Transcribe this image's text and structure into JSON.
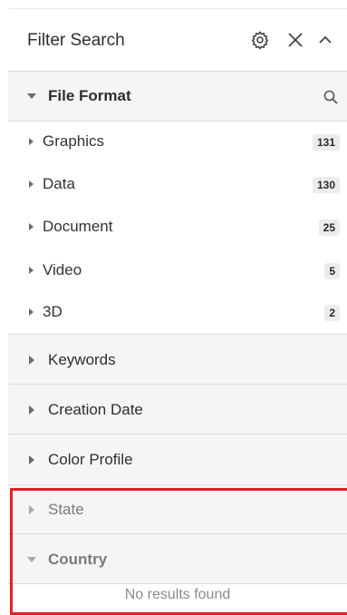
{
  "header": {
    "title": "Filter Search"
  },
  "file_format": {
    "label": "File Format",
    "items": [
      {
        "label": "Graphics",
        "count": "131"
      },
      {
        "label": "Data",
        "count": "130"
      },
      {
        "label": "Document",
        "count": "25"
      },
      {
        "label": "Video",
        "count": "5"
      },
      {
        "label": "3D",
        "count": "2"
      }
    ]
  },
  "sections": {
    "keywords": "Keywords",
    "creation_date": "Creation Date",
    "color_profile": "Color Profile",
    "state": "State",
    "country": "Country"
  },
  "country_empty": "No results found",
  "colors": {
    "highlight": "#e0202a",
    "section_bg": "#f5f5f5"
  },
  "icons": [
    "gear-icon",
    "close-icon",
    "chevron-up-icon",
    "search-icon",
    "caret-down-icon",
    "caret-right-icon"
  ]
}
